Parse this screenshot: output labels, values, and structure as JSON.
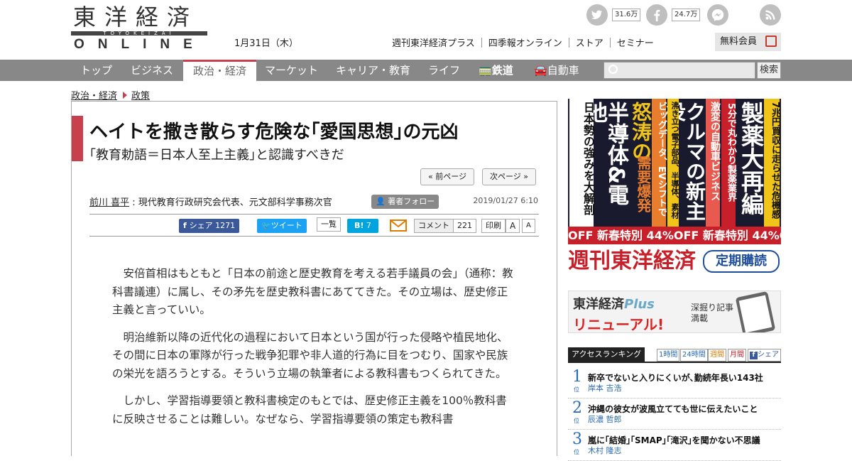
{
  "header": {
    "logo_kanji": "東洋経済",
    "logo_roman": "TOYOKEIZAI",
    "logo_online": "ONLINE",
    "date": "1月31日（木）",
    "social": [
      {
        "icon": "twitter-icon",
        "count": "31.6万"
      },
      {
        "icon": "facebook-icon",
        "count": "24.7万"
      },
      {
        "icon": "messenger-icon",
        "count": ""
      },
      {
        "icon": "rss-icon",
        "count": ""
      }
    ],
    "links": [
      "週刊東洋経済プラス",
      "四季報オンライン",
      "ストア",
      "セミナー"
    ],
    "member_label": "無料会員"
  },
  "nav": {
    "items": [
      "トップ",
      "ビジネス",
      "政治・経済",
      "マーケット",
      "キャリア・教育",
      "ライフ",
      "鉄道",
      "自動車"
    ],
    "active": "政治・経済",
    "search_placeholder": "",
    "search_button": "検索"
  },
  "breadcrumb": [
    "政治・経済",
    "政策"
  ],
  "article": {
    "title": "ヘイトを撒き散らす危険な｢愛国思想｣の元凶",
    "subtitle": "｢教育勅語＝日本人至上主義｣と認識すべきだ",
    "prev_label": "« 前ページ",
    "next_label": "次ページ »",
    "author_name": "前川 喜平",
    "author_desc": " : 現代教育行政研究会代表、元文部科学事務次官",
    "follow_label": "著者フォロー",
    "pub_date": "2019/01/27 6:10",
    "share": {
      "facebook_label": "シェア",
      "facebook_count": "1271",
      "tweet_label": "ツイート",
      "list_label": "一覧",
      "hatena_label": "B!",
      "hatena_count": "7",
      "comment_label": "コメント",
      "comment_count": "221",
      "print_label": "印刷",
      "font_large": "A",
      "font_small": "A"
    },
    "paragraphs": [
      "安倍首相はもともと「日本の前途と歴史教育を考える若手議員の会」（通称：教科書議連）に属し、その矛先を歴史教科書にあててきた。その立場は、歴史修正主義と言っていい。",
      "明治維新以降の近代化の過程において日本という国が行った侵略や植民地化、その間に日本の軍隊が行った戦争犯罪や非人道的行為に目をつむり、国家や民族の栄光を語ろうとする。そういう立場の執筆者による教科書もつくられてきた。",
      "しかし、学習指導要領と教科書検定のもとでは、歴史修正主義を100％教科書に反映させることは難しい。なぜなら、学習指導要領の策定も教科書"
    ]
  },
  "sidebar": {
    "ad1": {
      "columns": [
        "7兆円買収に走らせた危機感",
        "製薬大再編",
        "5分で丸わかり製薬業界",
        "激変の自動車ビジネス",
        "クルマの新主役",
        "沸き立つ電子部品、半導体、素材",
        "ビッグデータ、EVシフトで",
        "怒涛の",
        "需要爆発",
        "半導体&電池",
        "日本勢の強みを大解剖"
      ],
      "offer": "OFF 新春特別 44%OFF 新春特別 44%OFF",
      "brand": "週刊東洋経済",
      "subscribe": "定期購読"
    },
    "ad2": {
      "title": "東洋経済",
      "plus": "Plus",
      "renewal": "リニューアル!",
      "side": "深掘り記事満載"
    },
    "ranking": {
      "title": "アクセスランキング",
      "tabs": [
        "1時間",
        "24時間",
        "週間",
        "月間",
        "シェア"
      ],
      "items": [
        {
          "rank": "1",
          "title": "新卒でないと入りにくいが､勤続年長い143社",
          "author": "岸本 吉浩"
        },
        {
          "rank": "2",
          "title": "沖縄の彼女が波風立てても世に伝えたいこと",
          "author": "辰濃 哲郎"
        },
        {
          "rank": "3",
          "title": "嵐に｢結婚｣｢SMAP｣｢滝沢｣を聞かない不思議",
          "author": "木村 隆志"
        }
      ],
      "rank_suffix": "位"
    }
  },
  "colors": {
    "accent": "#c8404d",
    "nav_bg": "#888888",
    "rank_blue": "#2a6ab5",
    "facebook": "#3b5998",
    "twitter": "#1da1f2",
    "hatena": "#00a4de"
  }
}
